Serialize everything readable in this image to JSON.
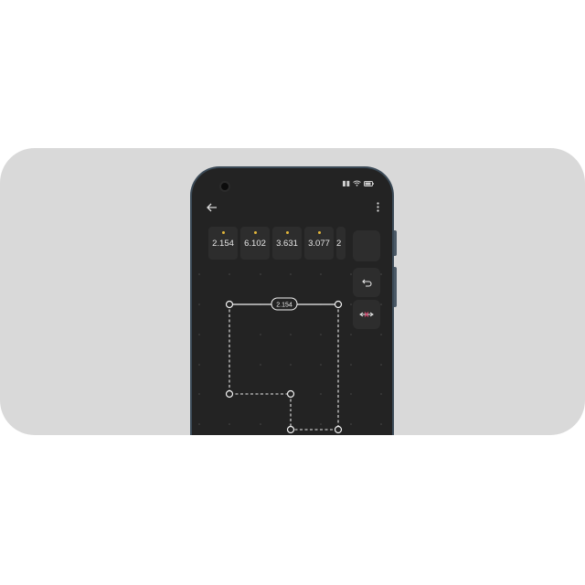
{
  "app": {
    "back_icon": "arrow-left-icon",
    "menu_icon": "more-vertical-icon"
  },
  "status_bar": {
    "icons": [
      "sim-icon",
      "wifi-icon",
      "battery-icon"
    ]
  },
  "chips": [
    {
      "value": "2.154",
      "marked": true
    },
    {
      "value": "6.102",
      "marked": true
    },
    {
      "value": "3.631",
      "marked": true
    },
    {
      "value": "3.077",
      "marked": true
    },
    {
      "value": "2",
      "marked": false
    }
  ],
  "tools": {
    "undo_icon": "undo-icon",
    "delete_edge_icon": "delete-edge-icon"
  },
  "board": {
    "edge_label": "2.154"
  },
  "colors": {
    "card_background": "#d9d9d9",
    "phone_frame": "#3b4a57",
    "screen_background": "#232323",
    "chip_background": "#2d2d2d",
    "marker_dot": "#e3b63a",
    "delete_accent": "#d0436a"
  }
}
